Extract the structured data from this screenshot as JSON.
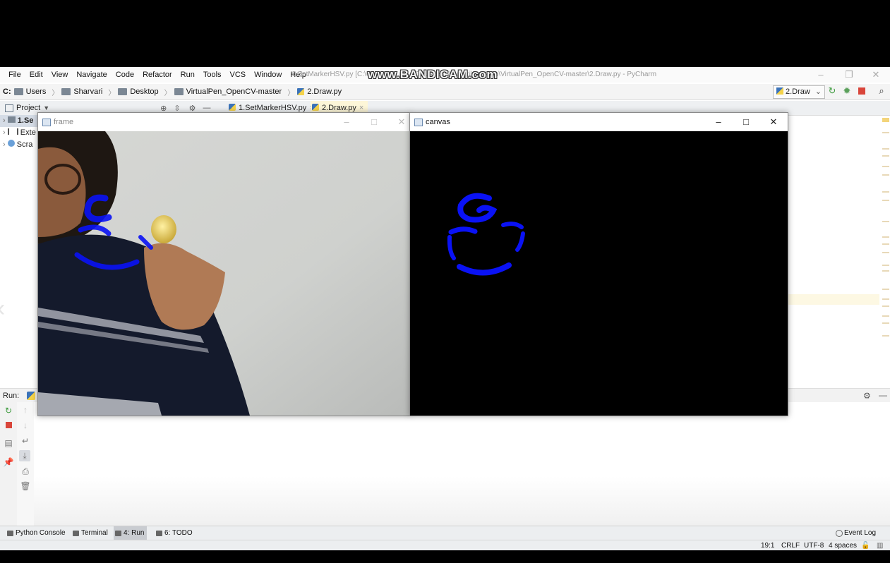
{
  "menu": [
    "File",
    "Edit",
    "View",
    "Navigate",
    "Code",
    "Refactor",
    "Run",
    "Tools",
    "VCS",
    "Window",
    "Help"
  ],
  "window_title": "1.SetMarkerHSV.py [C:\\U...erHSV.py] - C:\\Users\\Sharvari\\Desktop\\VirtualPen_OpenCV-master\\2.Draw.py - PyCharm",
  "watermark": "www.BANDICAM.com",
  "breadcrumb": [
    "C:",
    "Users",
    "Sharvari",
    "Desktop",
    "VirtualPen_OpenCV-master",
    "2.Draw.py"
  ],
  "run_config": "2.Draw",
  "project_label": "Project",
  "tabs": [
    {
      "label": "1.SetMarkerHSV.py",
      "close": "×"
    },
    {
      "label": "2.Draw.py",
      "close": "×"
    }
  ],
  "tree": [
    "1.Se",
    "Exte",
    "Scra"
  ],
  "run_label": "Run:",
  "frame_window": {
    "title": "frame",
    "minimize": "–",
    "maximize": "□",
    "close": "✕"
  },
  "canvas_window": {
    "title": "canvas",
    "minimize": "–",
    "maximize": "□",
    "close": "✕"
  },
  "bottom_tabs": [
    {
      "label": "Python Console"
    },
    {
      "label": "Terminal"
    },
    {
      "label": "4: Run"
    },
    {
      "label": "6: TODO"
    }
  ],
  "event_log": "Event Log",
  "status": {
    "position": "19:1",
    "line_sep": "CRLF",
    "encoding": "UTF-8",
    "indent": "4 spaces"
  },
  "colors": {
    "stroke": "#0a12f5",
    "marker": "#e8d466",
    "canvas_bg": "#000000"
  }
}
